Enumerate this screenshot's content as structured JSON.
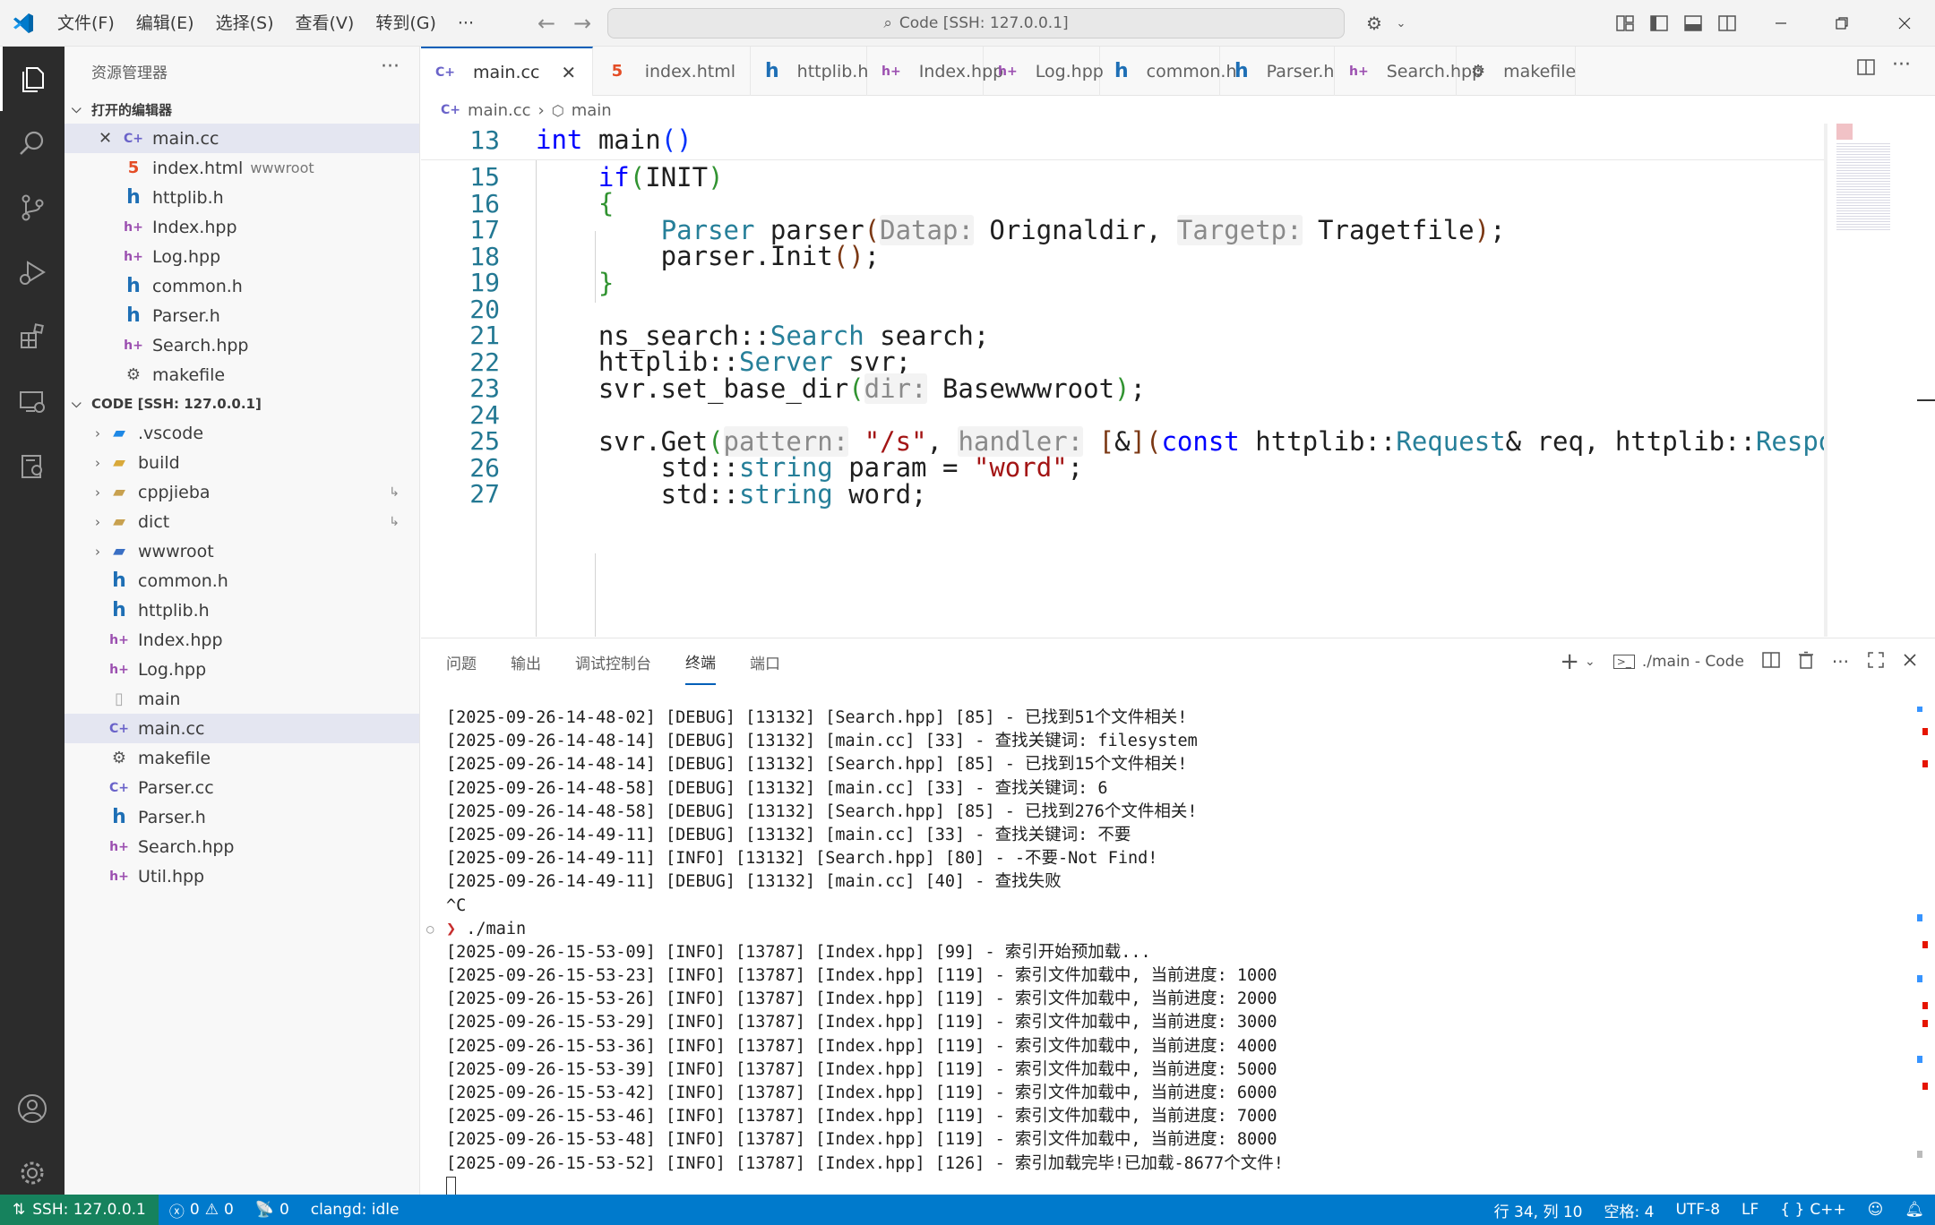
{
  "titlebar": {
    "menu": [
      "文件(F)",
      "编辑(E)",
      "选择(S)",
      "查看(V)",
      "转到(G)",
      "···"
    ],
    "search": "Code [SSH: 127.0.0.1]"
  },
  "sidebar": {
    "title": "资源管理器",
    "open_editors_header": "打开的编辑器",
    "open_editors": [
      {
        "name": "main.cc",
        "icon": "cpp"
      },
      {
        "name": "index.html",
        "desc": "wwwroot",
        "icon": "html"
      },
      {
        "name": "httplib.h",
        "icon": "h"
      },
      {
        "name": "Index.hpp",
        "icon": "hpp"
      },
      {
        "name": "Log.hpp",
        "icon": "hpp"
      },
      {
        "name": "common.h",
        "icon": "h"
      },
      {
        "name": "Parser.h",
        "icon": "h"
      },
      {
        "name": "Search.hpp",
        "icon": "hpp"
      },
      {
        "name": "makefile",
        "icon": "make"
      }
    ],
    "workspace_header": "CODE [SSH: 127.0.0.1]",
    "tree": [
      {
        "name": ".vscode",
        "type": "folder"
      },
      {
        "name": "build",
        "type": "folder"
      },
      {
        "name": "cppjieba",
        "type": "folder"
      },
      {
        "name": "dict",
        "type": "folder"
      },
      {
        "name": "wwwroot",
        "type": "folder"
      },
      {
        "name": "common.h",
        "type": "h"
      },
      {
        "name": "httplib.h",
        "type": "h"
      },
      {
        "name": "Index.hpp",
        "type": "hpp"
      },
      {
        "name": "Log.hpp",
        "type": "hpp"
      },
      {
        "name": "main",
        "type": "file"
      },
      {
        "name": "main.cc",
        "type": "cpp"
      },
      {
        "name": "makefile",
        "type": "make"
      },
      {
        "name": "Parser.cc",
        "type": "cpp"
      },
      {
        "name": "Parser.h",
        "type": "h"
      },
      {
        "name": "Search.hpp",
        "type": "hpp"
      },
      {
        "name": "Util.hpp",
        "type": "hpp"
      }
    ]
  },
  "tabs": [
    {
      "label": "main.cc",
      "icon": "cpp"
    },
    {
      "label": "index.html",
      "icon": "html"
    },
    {
      "label": "httplib.h",
      "icon": "h"
    },
    {
      "label": "Index.hpp",
      "icon": "hpp"
    },
    {
      "label": "Log.hpp",
      "icon": "hpp"
    },
    {
      "label": "common.h",
      "icon": "h"
    },
    {
      "label": "Parser.h",
      "icon": "h"
    },
    {
      "label": "Search.hpp",
      "icon": "hpp"
    },
    {
      "label": "makefile",
      "icon": "make"
    }
  ],
  "breadcrumb": {
    "file": "main.cc",
    "symbol": "main"
  },
  "editor": {
    "line_numbers": [
      "13",
      "15",
      "16",
      "17",
      "18",
      "19",
      "20",
      "21",
      "22",
      "23",
      "24",
      "25",
      "26",
      "27"
    ]
  },
  "panel": {
    "tabs": [
      "问题",
      "输出",
      "调试控制台",
      "终端",
      "端口"
    ],
    "terminal_name": "./main - Code",
    "lines": [
      "[2025-09-26-14-48-02] [DEBUG] [13132] [Search.hpp] [85] - 已找到51个文件相关!",
      "[2025-09-26-14-48-14] [DEBUG] [13132] [main.cc] [33] - 查找关键词: filesystem",
      "[2025-09-26-14-48-14] [DEBUG] [13132] [Search.hpp] [85] - 已找到15个文件相关!",
      "[2025-09-26-14-48-58] [DEBUG] [13132] [main.cc] [33] - 查找关键词: 6",
      "[2025-09-26-14-48-58] [DEBUG] [13132] [Search.hpp] [85] - 已找到276个文件相关!",
      "[2025-09-26-14-49-11] [DEBUG] [13132] [main.cc] [33] - 查找关键词: 不要",
      "[2025-09-26-14-49-11] [INFO] [13132] [Search.hpp] [80] - -不要-Not Find!",
      "[2025-09-26-14-49-11] [DEBUG] [13132] [main.cc] [40] - 查找失败",
      "^C",
      "./main",
      "[2025-09-26-15-53-09] [INFO] [13787] [Index.hpp] [99] - 索引开始预加载...",
      "[2025-09-26-15-53-23] [INFO] [13787] [Index.hpp] [119] - 索引文件加载中, 当前进度: 1000",
      "[2025-09-26-15-53-26] [INFO] [13787] [Index.hpp] [119] - 索引文件加载中, 当前进度: 2000",
      "[2025-09-26-15-53-29] [INFO] [13787] [Index.hpp] [119] - 索引文件加载中, 当前进度: 3000",
      "[2025-09-26-15-53-36] [INFO] [13787] [Index.hpp] [119] - 索引文件加载中, 当前进度: 4000",
      "[2025-09-26-15-53-39] [INFO] [13787] [Index.hpp] [119] - 索引文件加载中, 当前进度: 5000",
      "[2025-09-26-15-53-42] [INFO] [13787] [Index.hpp] [119] - 索引文件加载中, 当前进度: 6000",
      "[2025-09-26-15-53-46] [INFO] [13787] [Index.hpp] [119] - 索引文件加载中, 当前进度: 7000",
      "[2025-09-26-15-53-48] [INFO] [13787] [Index.hpp] [119] - 索引文件加载中, 当前进度: 8000",
      "[2025-09-26-15-53-52] [INFO] [13787] [Index.hpp] [126] - 索引加载完毕!已加载-8677个文件!"
    ]
  },
  "statusbar": {
    "remote": "SSH: 127.0.0.1",
    "errors": "0",
    "warnings": "0",
    "ports": "0",
    "clangd": "clangd: idle",
    "position": "行 34, 列 10",
    "spaces": "空格: 4",
    "encoding": "UTF-8",
    "eol": "LF",
    "language": "C++"
  },
  "colors": {
    "accent": "#007acc",
    "remote": "#16825d",
    "activitybar": "#2c2c2c"
  }
}
